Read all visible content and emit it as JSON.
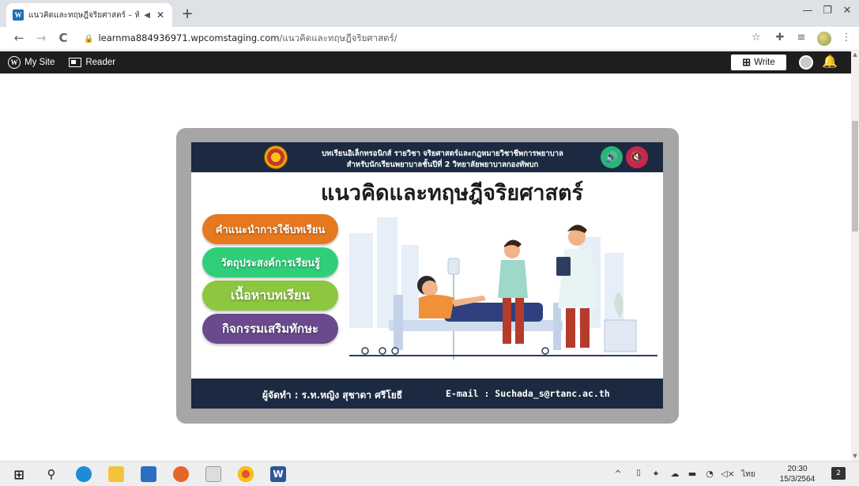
{
  "browser": {
    "tab_title": "แนวคิดและทฤษฎีจริยศาสตร์ – ห้อ",
    "favicon_glyph": "W",
    "audio_icon": "◀",
    "close_glyph": "✕",
    "new_tab_glyph": "+",
    "window_controls": [
      "—",
      "❐",
      "✕"
    ],
    "back_glyph": "←",
    "forward_glyph": "→",
    "reload_glyph": "C",
    "lock_glyph": "🔒",
    "url_host": "learnma884936971.wpcomstaging.com",
    "url_path": "/แนวคิดและทฤษฎีจริยศาสตร์/",
    "toolbar_icons": [
      "star-icon",
      "extensions-icon",
      "reading-list-icon",
      "profile-icon",
      "menu-icon"
    ],
    "star_glyph": "☆",
    "extensions_glyph": "✚",
    "reading_list_glyph": "≡",
    "menu_glyph": "⋮"
  },
  "wp_admin_bar": {
    "logo_glyph": "W",
    "my_site_label": "My Site",
    "reader_label": "Reader",
    "write_label": "Write",
    "write_glyph": "⊞",
    "notification_glyph": "🔔"
  },
  "scrollbar": {
    "up_glyph": "▲",
    "down_glyph": "▼"
  },
  "lesson": {
    "header_line1": "บทเรียนอิเล็กทรอนิกส์ รายวิชา จริยศาสตร์และกฎหมายวิชาชีพการพยาบาล",
    "header_line2": "สำหรับนักเรียนพยาบาลชั้นปีที่ 2 วิทยาลัยพยาบาลกองทัพบก",
    "sound_on_glyph": "🔊",
    "sound_off_glyph": "🔇",
    "title": "แนวคิดและทฤษฎีจริยศาสตร์",
    "menu": [
      {
        "label": "คำแนะนำการใช้บทเรียน"
      },
      {
        "label": "วัตถุประสงค์การเรียนรู้"
      },
      {
        "label": "เนื้อหาบทเรียน"
      },
      {
        "label": "กิจกรรมเสริมทักษะ"
      }
    ],
    "footer_author": "ผู้จัดทำ : ร.ท.หญิง สุชาดา ศรีโยธี",
    "footer_email": "E-mail : Suchada_s@rtanc.ac.th",
    "colors": {
      "header_bg": "#1b2a40",
      "menu_1": "#e6781e",
      "menu_2": "#2fcf7a",
      "menu_3": "#8dc63f",
      "menu_4": "#6a4a8c",
      "sound_on": "#29b478",
      "sound_off": "#c8264f"
    }
  },
  "taskbar": {
    "apps": [
      "windows-start-icon",
      "search-icon",
      "edge-icon",
      "file-explorer-icon",
      "mail-icon",
      "firefox-icon",
      "amazon-icon",
      "chrome-icon",
      "word-icon"
    ],
    "start_glyph": "⊞",
    "search_glyph": "⚲",
    "word_glyph": "W",
    "tray_chevron": "^",
    "tray_volume": "◁×",
    "language": "ไทย",
    "time": "20:30",
    "date": "15/3/2564",
    "notification_count": "2"
  }
}
